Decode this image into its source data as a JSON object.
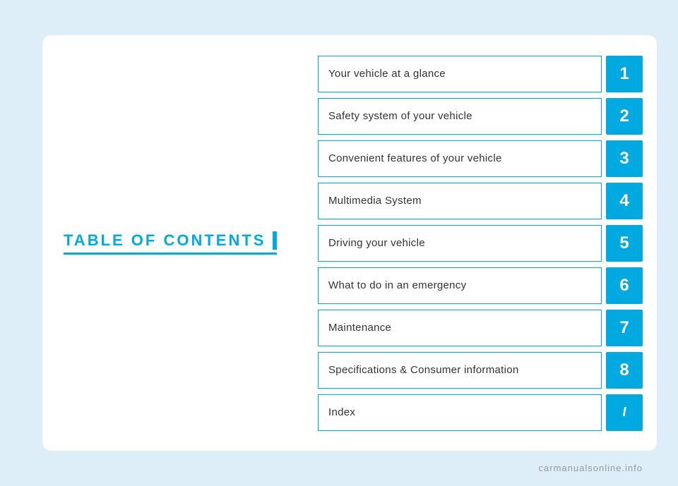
{
  "page": {
    "background_color": "#ddeef8",
    "watermark": "carmanualsonline.info"
  },
  "toc": {
    "title": "TABLE OF CONTENTS",
    "accent_color": "#00a9e0",
    "items": [
      {
        "label": "Your vehicle at a glance",
        "number": "1",
        "is_index": false
      },
      {
        "label": "Safety system of your vehicle",
        "number": "2",
        "is_index": false
      },
      {
        "label": "Convenient features of your vehicle",
        "number": "3",
        "is_index": false
      },
      {
        "label": "Multimedia System",
        "number": "4",
        "is_index": false
      },
      {
        "label": "Driving your vehicle",
        "number": "5",
        "is_index": false
      },
      {
        "label": "What to do in an emergency",
        "number": "6",
        "is_index": false
      },
      {
        "label": "Maintenance",
        "number": "7",
        "is_index": false
      },
      {
        "label": "Specifications & Consumer information",
        "number": "8",
        "is_index": false
      },
      {
        "label": "Index",
        "number": "I",
        "is_index": true
      }
    ]
  }
}
